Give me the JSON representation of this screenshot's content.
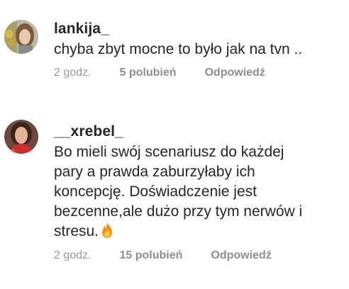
{
  "comments": [
    {
      "username": "lankija_",
      "lines": [
        "chyba zbyt mocne to było jak na tvn .."
      ],
      "time": "2 godz.",
      "likes": "5 polubień",
      "reply": "Odpowiedź",
      "avatar_icon": "avatar-woman-icon"
    },
    {
      "username": "__xrebel_",
      "lines": [
        "Bo mieli swój scenariusz do każdej",
        "pary a prawda zaburzyłaby ich",
        "koncepcję. Doświadczenie jest",
        "bezcenne,ale dużo przy tym nerwów i",
        "stresu."
      ],
      "emoji": "fire-emoji",
      "time": "2 godz.",
      "likes": "15 polubień",
      "reply": "Odpowiedź",
      "avatar_icon": "avatar-woman-icon"
    }
  ]
}
